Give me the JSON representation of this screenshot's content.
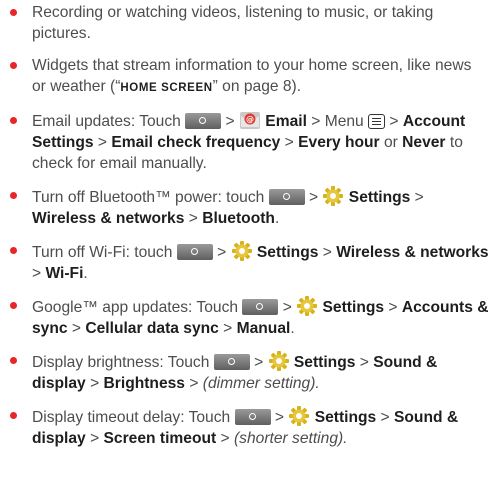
{
  "items": [
    {
      "text": "Recording or watching videos, listening to music, or taking pictures."
    },
    {
      "text_1": "Widgets that stream information to your home screen, like news or weather (“",
      "ref": "HOME SCREEN",
      "text_2": "” on page 8)."
    },
    {
      "prefix": "Email updates: Touch",
      "sep": ">",
      "email_label": "Email",
      "menu_text": "Menu",
      "path_1": "Account Settings",
      "path_2": "Email check frequency",
      "path_3": "Every hour",
      "or": "or",
      "path_4": "Never",
      "suffix": "to check for email manually."
    },
    {
      "prefix": "Turn off Bluetooth™ power: touch",
      "sep": ">",
      "settings_label": "Settings",
      "path_1": "Wireless & networks",
      "path_2": "Bluetooth",
      "end": "."
    },
    {
      "prefix": "Turn off Wi-Fi: touch",
      "sep": ">",
      "settings_label": "Settings",
      "path_1": "Wireless & networks",
      "path_2": "Wi-Fi",
      "end": "."
    },
    {
      "prefix": "Google™ app updates: Touch",
      "sep": ">",
      "settings_label": "Settings",
      "path_1": "Accounts & sync",
      "path_2": "Cellular data sync",
      "path_3": "Manual",
      "end": "."
    },
    {
      "prefix": "Display brightness: Touch",
      "sep": ">",
      "settings_label": "Settings",
      "path_1": "Sound & display",
      "path_2": "Brightness",
      "note": "(dimmer setting)."
    },
    {
      "prefix": "Display timeout delay: Touch",
      "sep": ">",
      "settings_label": "Settings",
      "path_1": "Sound & display",
      "path_2": "Screen timeout",
      "note": "(shorter setting)."
    }
  ],
  "colors": {
    "bullet": "#e8262a",
    "text": "#4d4d4d",
    "bold": "#1e1e1e",
    "gear": "#d8b21a"
  },
  "icons": [
    "home-key-icon",
    "email-icon",
    "menu-key-icon",
    "settings-gear-icon"
  ]
}
